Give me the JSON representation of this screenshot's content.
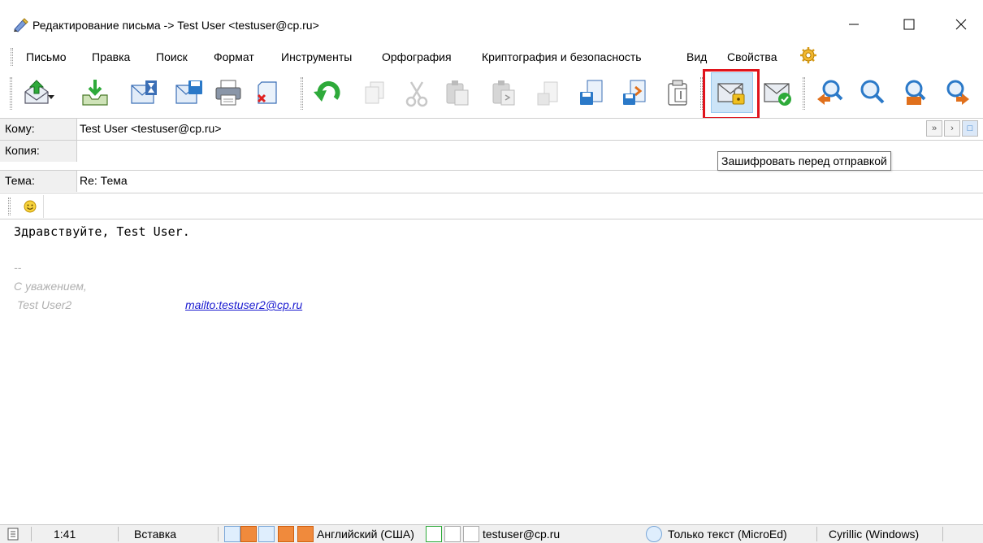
{
  "window": {
    "title": "Редактирование письма -> Test User <testuser@cp.ru>"
  },
  "menu": {
    "items": [
      "Письмо",
      "Правка",
      "Поиск",
      "Формат",
      "Инструменты",
      "Орфография",
      "Криптография и безопасность",
      "Вид",
      "Свойства"
    ]
  },
  "toolbar": {
    "buttons": [
      "send-icon",
      "save-draft-icon",
      "send-later-icon",
      "save-icon",
      "print-icon",
      "delete-icon",
      "undo-icon",
      "copy-disabled-icon",
      "cut-icon",
      "paste-icon",
      "paste-special-icon",
      "save-disabled-icon",
      "save-file-icon",
      "export-icon",
      "clipboard-icon",
      "encrypt-icon",
      "sign-icon",
      "find-prev-icon",
      "find-icon",
      "find-all-icon",
      "find-next-icon"
    ],
    "active": "encrypt-icon",
    "tooltip": "Зашифровать перед отправкой"
  },
  "fields": {
    "to": {
      "label": "Кому:",
      "value": "Test User <testuser@cp.ru>"
    },
    "cc": {
      "label": "Копия:",
      "value": ""
    },
    "subject": {
      "label": "Тема:",
      "value": "Re: Тема"
    }
  },
  "body": {
    "greeting": "Здравствуйте, Test User.",
    "sig_dash": "--",
    "sig_regards": "С уважением,",
    "sig_name": "Test User2",
    "sig_link": "mailto:testuser2@cp.ru"
  },
  "status": {
    "position": "1:41",
    "mode": "Вставка",
    "language": "Английский (США)",
    "account": "testuser@cp.ru",
    "format": "Только текст (MicroEd)",
    "encoding": "Cyrillic (Windows)"
  },
  "colors": {
    "highlight": "#e0141c",
    "accent_green": "#2eaa3a",
    "accent_blue": "#2b79c8"
  }
}
